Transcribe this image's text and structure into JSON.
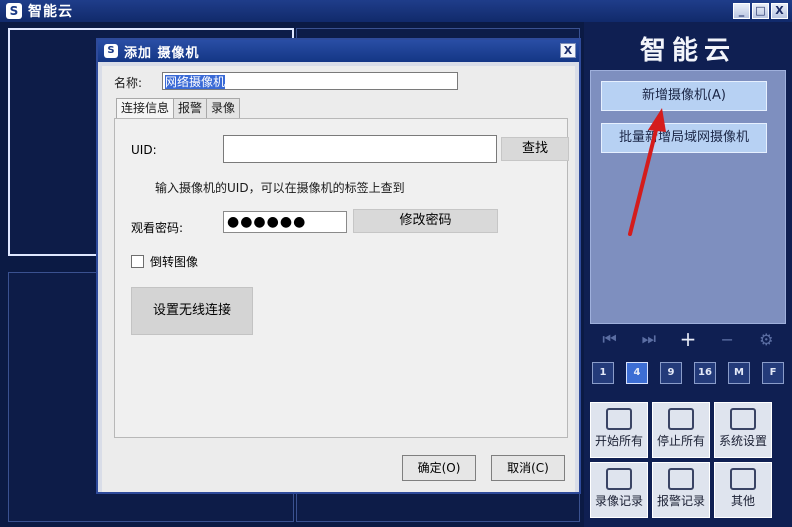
{
  "app": {
    "title": "智能云",
    "logo": "S",
    "window_buttons": {
      "minimize": "_",
      "maximize": "□",
      "close": "X"
    }
  },
  "right_panel": {
    "brand": "智能云",
    "add_camera": "新增摄像机(A)",
    "batch_add": "批量新增局域网摄像机",
    "nav_icons": [
      "first-icon",
      "last-icon",
      "plus-icon",
      "minus-icon",
      "gear-icon"
    ],
    "layouts": [
      "1",
      "4",
      "9",
      "16",
      "M",
      "F"
    ],
    "tiles": [
      {
        "label": "开始所有",
        "icon": "start-all-icon"
      },
      {
        "label": "停止所有",
        "icon": "stop-all-icon"
      },
      {
        "label": "系统设置",
        "icon": "settings-icon"
      },
      {
        "label": "录像记录",
        "icon": "record-log-icon"
      },
      {
        "label": "报警记录",
        "icon": "alarm-log-icon"
      },
      {
        "label": "其他",
        "icon": "tools-icon"
      }
    ]
  },
  "dialog": {
    "title": "添加 摄像机",
    "close": "X",
    "name_label": "名称:",
    "name_value": "网络摄像机",
    "tabs": [
      "连接信息",
      "报警",
      "录像"
    ],
    "uid_label": "UID:",
    "uid_value": "",
    "find_button": "查找",
    "uid_hint": "输入摄像机的UID，可以在摄像机的标签上查到",
    "password_label": "观看密码:",
    "password_value": "●●●●●●",
    "change_password_button": "修改密码",
    "flip_label": "倒转图像",
    "wifi_button": "设置无线连接",
    "ok_button": "确定(O)",
    "cancel_button": "取消(C)"
  },
  "colors": {
    "background": "#0c1a45",
    "accent": "#2a4ea5",
    "arrow": "#d41c1c"
  }
}
